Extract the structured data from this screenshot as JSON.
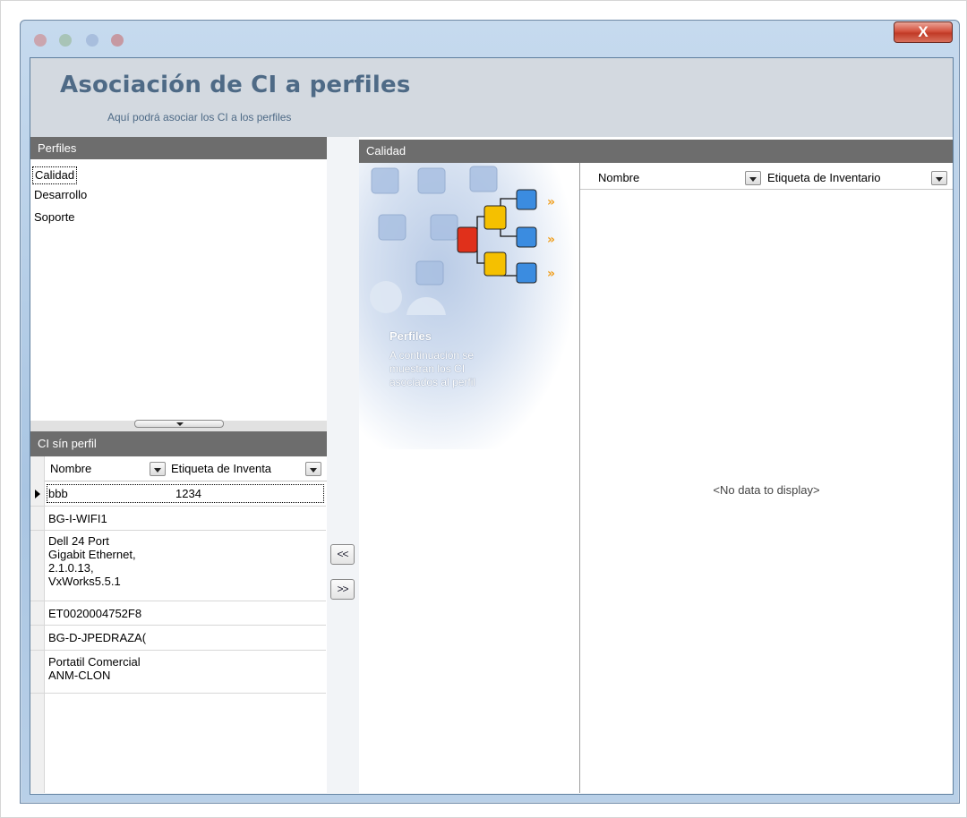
{
  "window": {
    "close_glyph": "X",
    "title": "Asociación de CI a perfiles",
    "subtitle": "Aquí podrá asociar los CI a los perfiles"
  },
  "profiles_panel": {
    "header": "Perfiles",
    "items": [
      "Calidad",
      "Desarrollo",
      "Soporte"
    ],
    "selected_index": 0
  },
  "unassigned_panel": {
    "header": "CI sín perfil",
    "columns": [
      "Nombre",
      "Etiqueta de Inventa"
    ],
    "rows": [
      {
        "name": "bbb",
        "tag": "1234"
      },
      {
        "name": "BG-I-WIFI1",
        "tag": ""
      },
      {
        "name": "Dell 24 Port\nGigabit Ethernet,\n2.1.0.13,\nVxWorks5.5.1",
        "tag": ""
      },
      {
        "name": "ET0020004752F8",
        "tag": ""
      },
      {
        "name": "BG-D-JPEDRAZA(",
        "tag": ""
      },
      {
        "name": "Portatil Comercial\nANM-CLON",
        "tag": ""
      }
    ]
  },
  "buttons": {
    "add": "<<",
    "remove": ">>"
  },
  "assigned_panel": {
    "header": "Calidad",
    "info_title": "Perfiles",
    "info_text": "A continuación se\nmuestran los CI\nasociados al perfil",
    "columns": [
      "Nombre",
      "Etiqueta de Inventario"
    ],
    "empty_text": "<No data to display>"
  },
  "colors": {
    "header_bg": "#d3d9e0",
    "title_color": "#4e6a86",
    "panel_header_bg": "#6d6d6d"
  }
}
